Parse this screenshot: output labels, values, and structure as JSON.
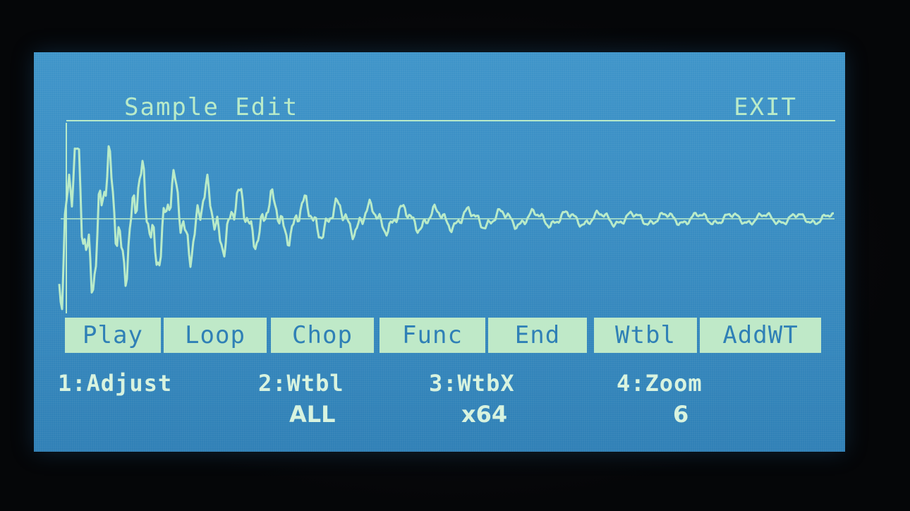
{
  "header": {
    "title": "Sample Edit",
    "exit_label": "EXIT"
  },
  "menu": [
    {
      "label": "Play"
    },
    {
      "label": "Loop"
    },
    {
      "label": "Chop"
    },
    {
      "label": "Func"
    },
    {
      "label": "End"
    },
    {
      "label": "Wtbl"
    },
    {
      "label": "AddWT"
    }
  ],
  "params": [
    {
      "label": "1:Adjust",
      "value": ""
    },
    {
      "label": "2:Wtbl",
      "value": "ALL"
    },
    {
      "label": "3:WtbX",
      "value": "x64"
    },
    {
      "label": "4:Zoom",
      "value": "6"
    }
  ],
  "colors": {
    "screen": "#3a8fc4",
    "foreground": "#b9ebc9",
    "button_bg": "#bfe9c8"
  }
}
